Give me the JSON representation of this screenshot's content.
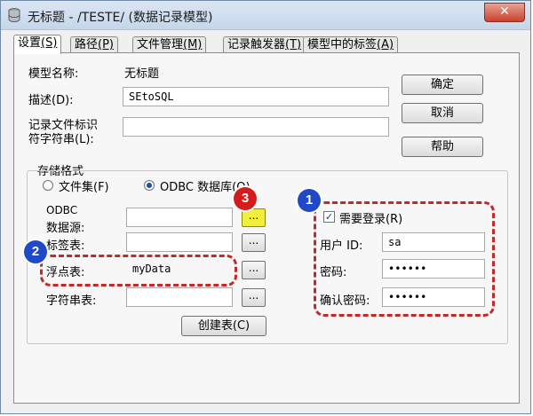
{
  "window": {
    "title": "无标题 - /TESTE/ (数据记录模型)",
    "close_label": "✕"
  },
  "tabs": [
    {
      "label": "设置",
      "key": "(S)"
    },
    {
      "label": "路径",
      "key": "(P)"
    },
    {
      "label": "文件管理",
      "key": "(M)"
    },
    {
      "label": "记录触发器",
      "key": "(T)"
    },
    {
      "label": "模型中的标签",
      "key": "(A)"
    }
  ],
  "form": {
    "model_name_label": "模型名称:",
    "model_name_value": "无标题",
    "description_label": "描述(D):",
    "description_value": "SEtoSQL",
    "record_file_label_line1": "记录文件标识",
    "record_file_label_line2": "符字符串(L):",
    "record_file_value": ""
  },
  "buttons": {
    "ok": "确定",
    "cancel": "取消",
    "help": "帮助",
    "create_table": "创建表(C)",
    "browse": "..."
  },
  "storage": {
    "group_label": "存储格式",
    "option_fileset": "文件集(F)",
    "option_odbc": "ODBC 数据库(O)",
    "selected": "ODBC 数据库(O)",
    "odbc_label_line1": "ODBC",
    "odbc_label_line2": "数据源:",
    "odbc_value": "",
    "tag_table_label": "标签表:",
    "tag_table_value": "",
    "float_table_label": "浮点表:",
    "float_table_value": "myData",
    "string_table_label": "字符串表:",
    "string_table_value": ""
  },
  "login": {
    "require_login_label": "需要登录(R)",
    "require_login_checked": true,
    "user_id_label": "用户 ID:",
    "user_id_value": "sa",
    "password_label": "密码:",
    "password_value": "••••••",
    "confirm_password_label": "确认密码:",
    "confirm_password_value": "••••••"
  },
  "annotations": {
    "badge1": "1",
    "badge2": "2",
    "badge3": "3"
  },
  "colors": {
    "highlight_dash": "#c22a2a",
    "badge_blue": "#1f49c7",
    "badge_red": "#d41c1c",
    "browse_highlight": "#f2ef3a"
  }
}
